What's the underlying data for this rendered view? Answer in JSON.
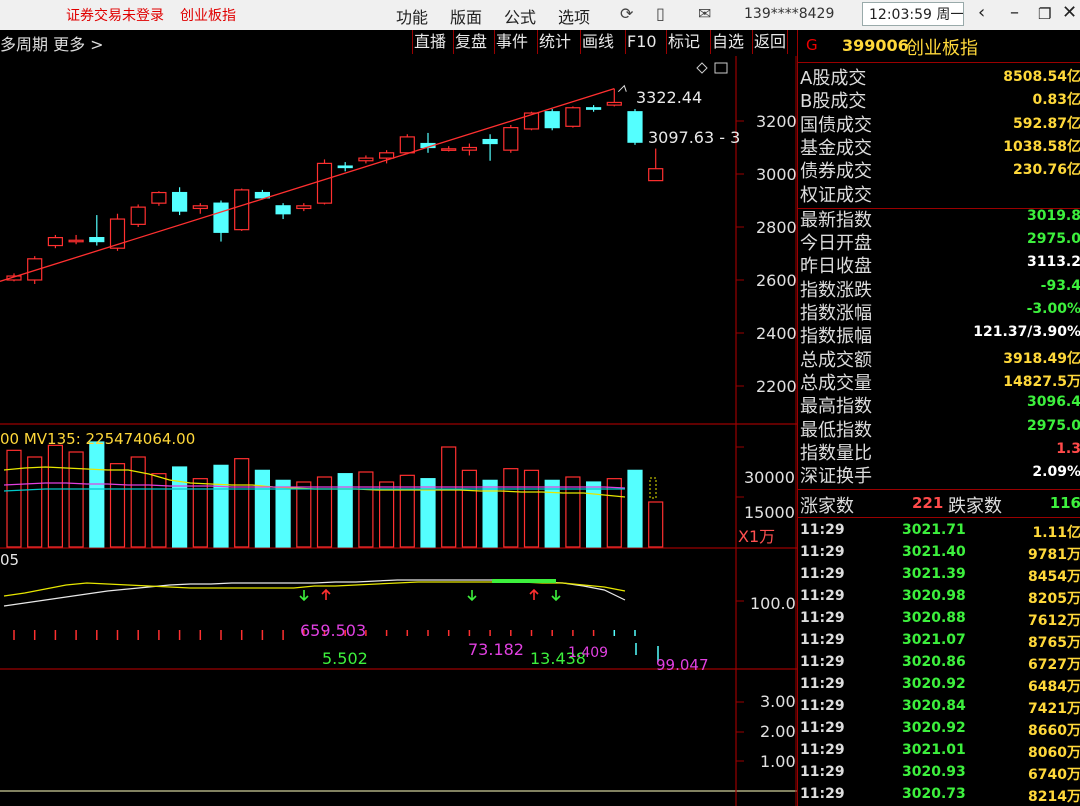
{
  "topbar": {
    "login_status": "证券交易未登录",
    "title": "创业板指",
    "menu": [
      "功能",
      "版面",
      "公式",
      "选项"
    ],
    "phone": "139****8429",
    "clock": "12:03:59 周一",
    "icons": [
      "refresh-icon",
      "phone-icon",
      "mail-icon",
      "back-icon",
      "minimize-icon",
      "restore-icon",
      "close-icon"
    ]
  },
  "subbar": {
    "left_text": "多周期 更多 >",
    "buttons": [
      "直播",
      "复盘",
      "事件",
      "统计",
      "画线",
      "F10",
      "标记",
      "自选",
      "返回"
    ]
  },
  "chart": {
    "high_label": "3322.44",
    "mid_label": "3097.63 - 3",
    "y_axis": [
      "3200",
      "3000",
      "2800",
      "2600",
      "2400",
      "2200"
    ],
    "vol_legend": "00  MV135: 225474064.00",
    "vol_axis": [
      "30000",
      "15000"
    ],
    "vol_unit": "X1万",
    "ind_legend": "05",
    "ind_axis": [
      "100.0"
    ],
    "ind_labels": [
      "659.503",
      "5.502",
      "73.182",
      "13.438",
      "1.409",
      "99.047"
    ],
    "low_axis": [
      "3.00",
      "2.00",
      "1.00"
    ],
    "colors": {
      "up": "#ff3030",
      "down": "#54ffff",
      "trend": "#ff3030",
      "ma_white": "#e8e8e8",
      "ma_yellow": "#e6e600",
      "ma_magenta": "#e040e0",
      "green": "#3df03d"
    }
  },
  "chart_data": {
    "type": "candlestick",
    "title": "",
    "ylim": [
      2100,
      3400
    ],
    "candles": [
      {
        "o": 2600,
        "h": 2625,
        "l": 2595,
        "c": 2615
      },
      {
        "o": 2600,
        "h": 2690,
        "l": 2585,
        "c": 2680
      },
      {
        "o": 2730,
        "h": 2770,
        "l": 2720,
        "c": 2760
      },
      {
        "o": 2745,
        "h": 2770,
        "l": 2735,
        "c": 2750
      },
      {
        "o": 2760,
        "h": 2845,
        "l": 2730,
        "c": 2745
      },
      {
        "o": 2720,
        "h": 2850,
        "l": 2710,
        "c": 2830
      },
      {
        "o": 2810,
        "h": 2885,
        "l": 2800,
        "c": 2875
      },
      {
        "o": 2890,
        "h": 2935,
        "l": 2880,
        "c": 2930
      },
      {
        "o": 2930,
        "h": 2950,
        "l": 2845,
        "c": 2860
      },
      {
        "o": 2870,
        "h": 2890,
        "l": 2850,
        "c": 2880
      },
      {
        "o": 2890,
        "h": 2900,
        "l": 2745,
        "c": 2780
      },
      {
        "o": 2790,
        "h": 2945,
        "l": 2785,
        "c": 2940
      },
      {
        "o": 2930,
        "h": 2940,
        "l": 2910,
        "c": 2910
      },
      {
        "o": 2880,
        "h": 2890,
        "l": 2830,
        "c": 2850
      },
      {
        "o": 2870,
        "h": 2890,
        "l": 2860,
        "c": 2880
      },
      {
        "o": 2890,
        "h": 3055,
        "l": 2885,
        "c": 3040
      },
      {
        "o": 3030,
        "h": 3045,
        "l": 3010,
        "c": 3025
      },
      {
        "o": 3050,
        "h": 3070,
        "l": 3040,
        "c": 3060
      },
      {
        "o": 3060,
        "h": 3090,
        "l": 3040,
        "c": 3080
      },
      {
        "o": 3080,
        "h": 3150,
        "l": 3075,
        "c": 3140
      },
      {
        "o": 3115,
        "h": 3155,
        "l": 3080,
        "c": 3100
      },
      {
        "o": 3095,
        "h": 3105,
        "l": 3085,
        "c": 3095
      },
      {
        "o": 3090,
        "h": 3115,
        "l": 3070,
        "c": 3100
      },
      {
        "o": 3130,
        "h": 3150,
        "l": 3050,
        "c": 3115
      },
      {
        "o": 3090,
        "h": 3185,
        "l": 3080,
        "c": 3175
      },
      {
        "o": 3170,
        "h": 3235,
        "l": 3165,
        "c": 3230
      },
      {
        "o": 3235,
        "h": 3245,
        "l": 3165,
        "c": 3175
      },
      {
        "o": 3180,
        "h": 3255,
        "l": 3175,
        "c": 3250
      },
      {
        "o": 3250,
        "h": 3260,
        "l": 3235,
        "c": 3245
      },
      {
        "o": 3260,
        "h": 3322,
        "l": 3255,
        "c": 3270
      },
      {
        "o": 3235,
        "h": 3245,
        "l": 3110,
        "c": 3120
      },
      {
        "o": 2975,
        "h": 3096,
        "l": 2975,
        "c": 3020
      }
    ],
    "volume": [
      29000,
      27000,
      30500,
      28500,
      31500,
      25000,
      27000,
      22000,
      24000,
      20500,
      24500,
      26500,
      23000,
      20000,
      19500,
      21000,
      22000,
      22500,
      19500,
      21500,
      20500,
      30000,
      23000,
      20000,
      23500,
      23000,
      20000,
      21000,
      19500,
      20500,
      23000,
      13500
    ],
    "vol_ylim": [
      0,
      36000
    ]
  },
  "panel": {
    "code": "399006",
    "name": "创业板指",
    "rows": [
      {
        "k": "A股成交",
        "v": "8508.54亿",
        "c": "#ffd83a"
      },
      {
        "k": "B股成交",
        "v": "0.83亿",
        "c": "#ffd83a"
      },
      {
        "k": "国债成交",
        "v": "592.87亿",
        "c": "#ffd83a"
      },
      {
        "k": "基金成交",
        "v": "1038.58亿",
        "c": "#ffd83a"
      },
      {
        "k": "债券成交",
        "v": "230.76亿",
        "c": "#ffd83a"
      },
      {
        "k": "权证成交",
        "v": "",
        "c": "#ffd83a"
      },
      {
        "k": "最新指数",
        "v": "3019.8",
        "c": "#3df03d"
      },
      {
        "k": "今日开盘",
        "v": "2975.0",
        "c": "#3df03d"
      },
      {
        "k": "昨日收盘",
        "v": "3113.2",
        "c": "#ffffff"
      },
      {
        "k": "指数涨跌",
        "v": "-93.4",
        "c": "#3df03d"
      },
      {
        "k": "指数涨幅",
        "v": "-3.00%",
        "c": "#3df03d"
      },
      {
        "k": "指数振幅",
        "v": "121.37/3.90%",
        "c": "#ffffff"
      },
      {
        "k": "总成交额",
        "v": "3918.49亿",
        "c": "#ffd83a"
      },
      {
        "k": "总成交量",
        "v": "14827.5万",
        "c": "#ffd83a"
      },
      {
        "k": "最高指数",
        "v": "3096.4",
        "c": "#3df03d"
      },
      {
        "k": "最低指数",
        "v": "2975.0",
        "c": "#3df03d"
      },
      {
        "k": "指数量比",
        "v": "1.3",
        "c": "#ff4a4a"
      },
      {
        "k": "深证换手",
        "v": "2.09%",
        "c": "#ffffff"
      }
    ],
    "breadth": {
      "up_label": "涨家数",
      "up": "221",
      "down_label": "跌家数",
      "down": "116"
    },
    "ticks": [
      {
        "t": "11:29",
        "p": "3021.71",
        "q": "1.11亿"
      },
      {
        "t": "11:29",
        "p": "3021.40",
        "q": "9781万"
      },
      {
        "t": "11:29",
        "p": "3021.39",
        "q": "8454万"
      },
      {
        "t": "11:29",
        "p": "3020.98",
        "q": "8205万"
      },
      {
        "t": "11:29",
        "p": "3020.88",
        "q": "7612万"
      },
      {
        "t": "11:29",
        "p": "3021.07",
        "q": "8765万"
      },
      {
        "t": "11:29",
        "p": "3020.86",
        "q": "6727万"
      },
      {
        "t": "11:29",
        "p": "3020.92",
        "q": "6484万"
      },
      {
        "t": "11:29",
        "p": "3020.84",
        "q": "7421万"
      },
      {
        "t": "11:29",
        "p": "3020.92",
        "q": "8660万"
      },
      {
        "t": "11:29",
        "p": "3021.01",
        "q": "8060万"
      },
      {
        "t": "11:29",
        "p": "3020.93",
        "q": "6740万"
      },
      {
        "t": "11:29",
        "p": "3020.73",
        "q": "8214万"
      }
    ]
  }
}
